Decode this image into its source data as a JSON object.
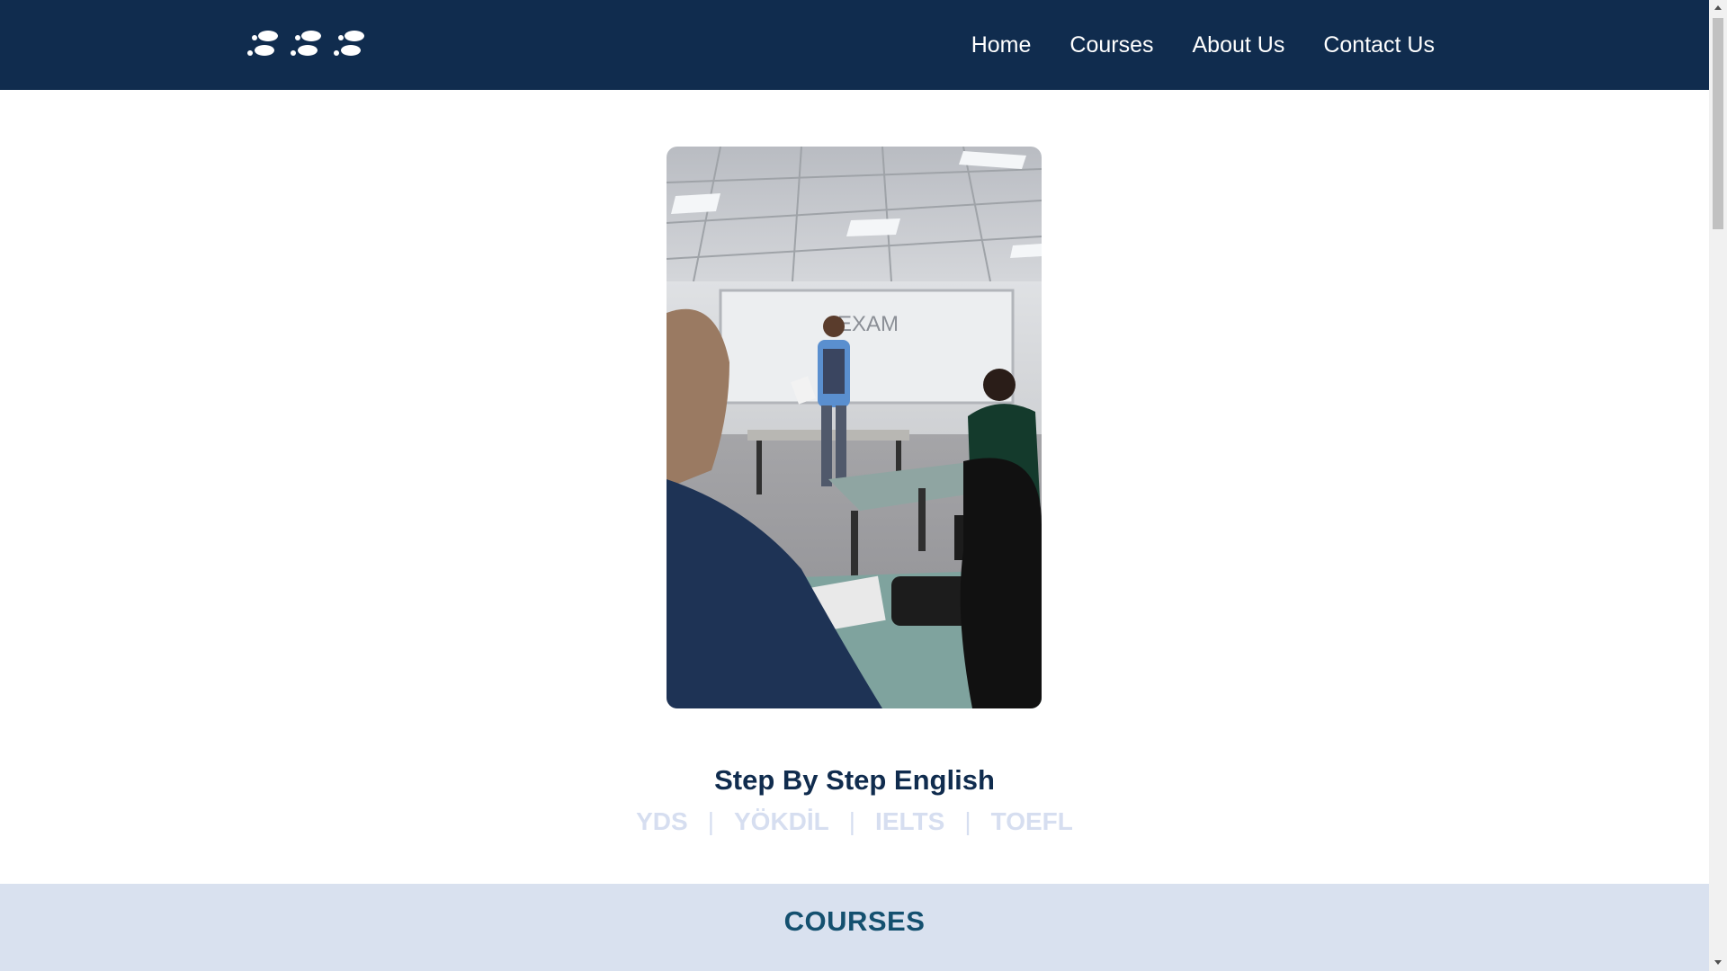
{
  "header": {
    "logo_icon": "footsteps-icon",
    "nav": [
      {
        "label": "Home"
      },
      {
        "label": "Courses"
      },
      {
        "label": "About Us"
      },
      {
        "label": "Contact Us"
      }
    ]
  },
  "hero": {
    "image_icon": "classroom-photo",
    "title": "Step By Step English",
    "exams": [
      "YDS",
      "YÖKDİL",
      "IELTS",
      "TOEFL"
    ],
    "separator": "|"
  },
  "courses": {
    "title": "COURSES"
  },
  "colors": {
    "navbar": "#102c4e",
    "title": "#102c4e",
    "exam_text": "#d6def0",
    "courses_band": "#d9e1ef",
    "courses_title": "#14506f"
  }
}
